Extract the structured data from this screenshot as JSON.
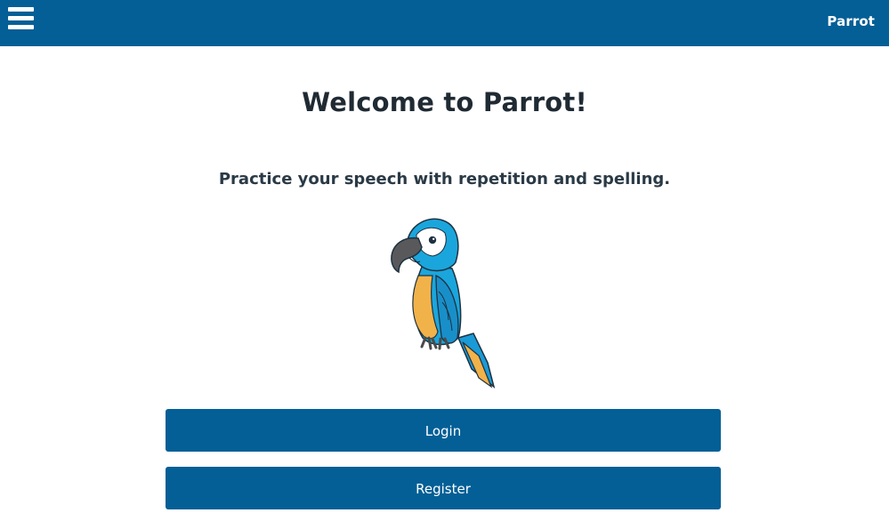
{
  "header": {
    "brand": "Parrot",
    "menu_icon": "hamburger-menu-icon",
    "background_color": "#035f96"
  },
  "main": {
    "title": "Welcome to Parrot!",
    "subtitle": "Practice your speech with repetition and spelling.",
    "illustration": "parrot-illustration"
  },
  "actions": {
    "login_label": "Login",
    "register_label": "Register",
    "button_color": "#035f96"
  }
}
